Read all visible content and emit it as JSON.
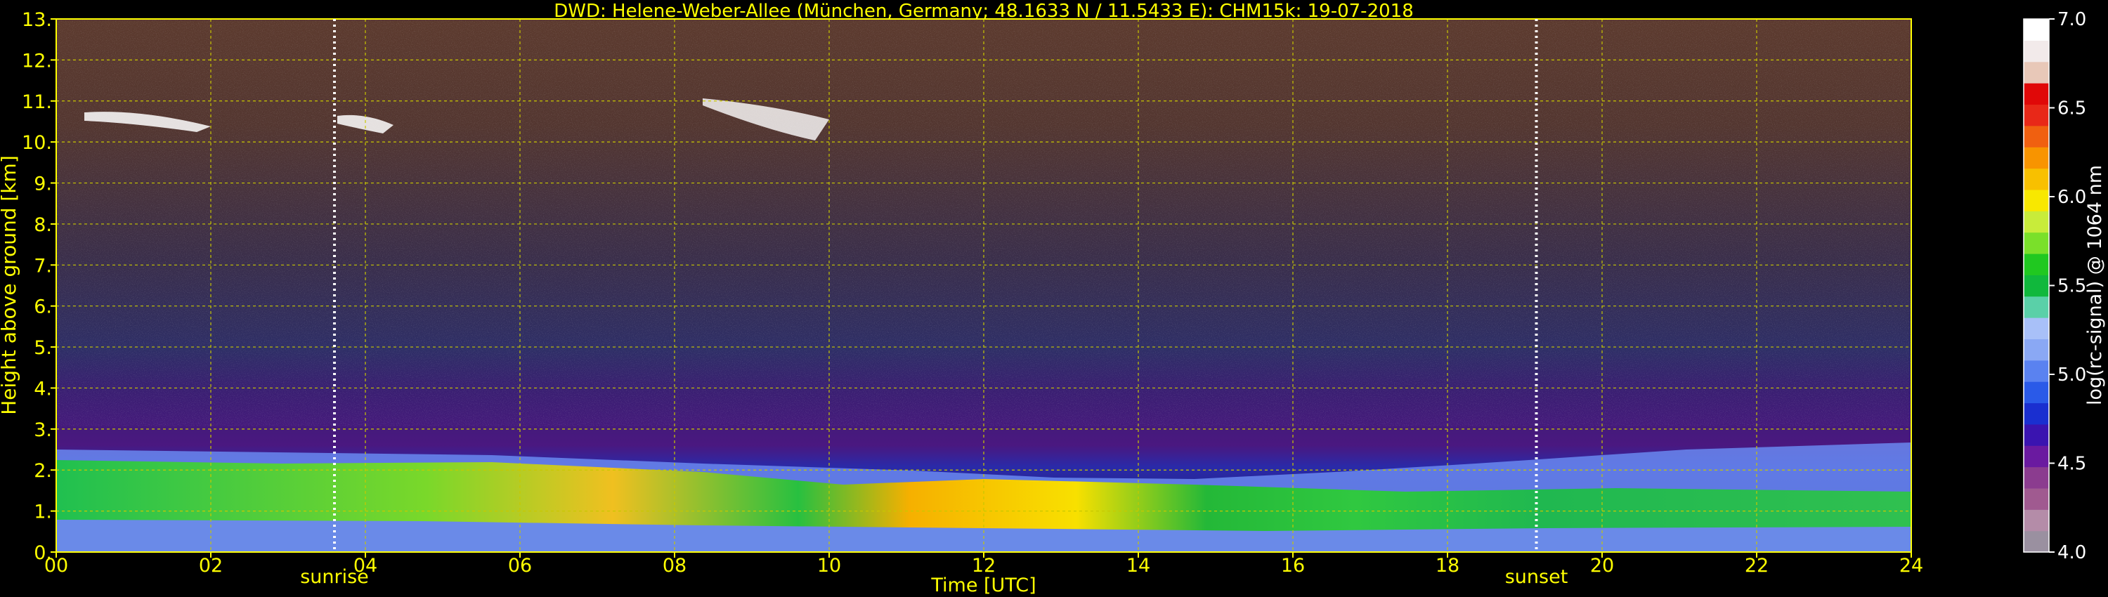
{
  "chart_data": {
    "type": "heatmap",
    "title": "DWD: Helene-Weber-Allee (München, Germany; 48.1633 N / 11.5433 E):    CHM15k: 19-07-2018",
    "xlabel": "Time [UTC]",
    "ylabel": "Height above ground [km]",
    "xlim": [
      0,
      24
    ],
    "ylim": [
      0,
      13
    ],
    "x_ticks": [
      "00",
      "02",
      "04",
      "06",
      "08",
      "10",
      "12",
      "14",
      "16",
      "18",
      "20",
      "22",
      "24"
    ],
    "y_ticks": [
      "0.",
      "1.",
      "2.",
      "3.",
      "4.",
      "5.",
      "6.",
      "7.",
      "8.",
      "9.",
      "10.",
      "11.",
      "12.",
      "13."
    ],
    "grid": true,
    "markers": [
      {
        "label": "sunrise",
        "time": 3.6
      },
      {
        "label": "sunset",
        "time": 19.15
      }
    ],
    "colorbar": {
      "label": "log(rc-signal) @ 1064 nm",
      "range": [
        4.0,
        7.0
      ],
      "ticks": [
        "4.0",
        "4.5",
        "5.0",
        "5.5",
        "6.0",
        "6.5",
        "7.0"
      ],
      "colors": [
        "#9a90a0",
        "#b48ca8",
        "#a05a90",
        "#8b3c8f",
        "#6a1aa0",
        "#3a14b0",
        "#1a2fd0",
        "#2a5ae8",
        "#5a82f0",
        "#8aa8f4",
        "#a8c0f8",
        "#5ad0a8",
        "#10b83c",
        "#20c820",
        "#7ae02a",
        "#c8ec3a",
        "#f8e800",
        "#f8c000",
        "#f89400",
        "#f06010",
        "#e82818",
        "#e00808",
        "#e8c8b8",
        "#f2eaea",
        "#ffffff"
      ]
    }
  }
}
